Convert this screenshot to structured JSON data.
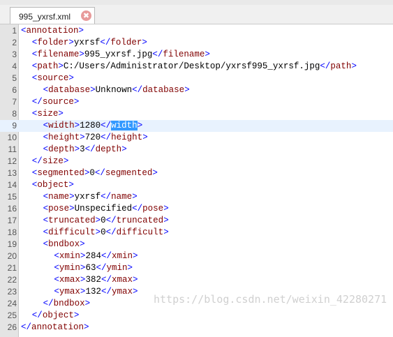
{
  "tab": {
    "name": "995_yxrsf.xml",
    "close_glyph": "✖"
  },
  "watermark": "https://blog.csdn.net/weixin_42280271",
  "current_line": 9,
  "lines": [
    {
      "n": "1",
      "indent": 0,
      "parts": [
        [
          "b",
          "<"
        ],
        [
          "t",
          "annotation"
        ],
        [
          "b",
          ">"
        ]
      ]
    },
    {
      "n": "2",
      "indent": 1,
      "parts": [
        [
          "b",
          "<"
        ],
        [
          "t",
          "folder"
        ],
        [
          "b",
          ">"
        ],
        [
          "x",
          "yxrsf"
        ],
        [
          "b",
          "</"
        ],
        [
          "t",
          "folder"
        ],
        [
          "b",
          ">"
        ]
      ]
    },
    {
      "n": "3",
      "indent": 1,
      "parts": [
        [
          "b",
          "<"
        ],
        [
          "t",
          "filename"
        ],
        [
          "b",
          ">"
        ],
        [
          "x",
          "995_yxrsf.jpg"
        ],
        [
          "b",
          "</"
        ],
        [
          "t",
          "filename"
        ],
        [
          "b",
          ">"
        ]
      ]
    },
    {
      "n": "4",
      "indent": 1,
      "parts": [
        [
          "b",
          "<"
        ],
        [
          "t",
          "path"
        ],
        [
          "b",
          ">"
        ],
        [
          "x",
          "C:/Users/Administrator/Desktop/yxrsf995_yxrsf.jpg"
        ],
        [
          "b",
          "</"
        ],
        [
          "t",
          "path"
        ],
        [
          "b",
          ">"
        ]
      ]
    },
    {
      "n": "5",
      "indent": 1,
      "parts": [
        [
          "b",
          "<"
        ],
        [
          "t",
          "source"
        ],
        [
          "b",
          ">"
        ]
      ]
    },
    {
      "n": "6",
      "indent": 2,
      "parts": [
        [
          "b",
          "<"
        ],
        [
          "t",
          "database"
        ],
        [
          "b",
          ">"
        ],
        [
          "x",
          "Unknown"
        ],
        [
          "b",
          "</"
        ],
        [
          "t",
          "database"
        ],
        [
          "b",
          ">"
        ]
      ]
    },
    {
      "n": "7",
      "indent": 1,
      "parts": [
        [
          "b",
          "</"
        ],
        [
          "t",
          "source"
        ],
        [
          "b",
          ">"
        ]
      ]
    },
    {
      "n": "8",
      "indent": 1,
      "parts": [
        [
          "b",
          "<"
        ],
        [
          "t",
          "size"
        ],
        [
          "b",
          ">"
        ]
      ]
    },
    {
      "n": "9",
      "indent": 2,
      "parts": [
        [
          "b",
          "<"
        ],
        [
          "t",
          "width"
        ],
        [
          "b",
          ">"
        ],
        [
          "x",
          "1280"
        ],
        [
          "b",
          "</"
        ],
        [
          "sel",
          "width"
        ],
        [
          "b",
          ">"
        ]
      ]
    },
    {
      "n": "10",
      "indent": 2,
      "parts": [
        [
          "b",
          "<"
        ],
        [
          "t",
          "height"
        ],
        [
          "b",
          ">"
        ],
        [
          "x",
          "720"
        ],
        [
          "b",
          "</"
        ],
        [
          "t",
          "height"
        ],
        [
          "b",
          ">"
        ]
      ]
    },
    {
      "n": "11",
      "indent": 2,
      "parts": [
        [
          "b",
          "<"
        ],
        [
          "t",
          "depth"
        ],
        [
          "b",
          ">"
        ],
        [
          "x",
          "3"
        ],
        [
          "b",
          "</"
        ],
        [
          "t",
          "depth"
        ],
        [
          "b",
          ">"
        ]
      ]
    },
    {
      "n": "12",
      "indent": 1,
      "parts": [
        [
          "b",
          "</"
        ],
        [
          "t",
          "size"
        ],
        [
          "b",
          ">"
        ]
      ]
    },
    {
      "n": "13",
      "indent": 1,
      "parts": [
        [
          "b",
          "<"
        ],
        [
          "t",
          "segmented"
        ],
        [
          "b",
          ">"
        ],
        [
          "x",
          "0"
        ],
        [
          "b",
          "</"
        ],
        [
          "t",
          "segmented"
        ],
        [
          "b",
          ">"
        ]
      ]
    },
    {
      "n": "14",
      "indent": 1,
      "parts": [
        [
          "b",
          "<"
        ],
        [
          "t",
          "object"
        ],
        [
          "b",
          ">"
        ]
      ]
    },
    {
      "n": "15",
      "indent": 2,
      "parts": [
        [
          "b",
          "<"
        ],
        [
          "t",
          "name"
        ],
        [
          "b",
          ">"
        ],
        [
          "x",
          "yxrsf"
        ],
        [
          "b",
          "</"
        ],
        [
          "t",
          "name"
        ],
        [
          "b",
          ">"
        ]
      ]
    },
    {
      "n": "16",
      "indent": 2,
      "parts": [
        [
          "b",
          "<"
        ],
        [
          "t",
          "pose"
        ],
        [
          "b",
          ">"
        ],
        [
          "x",
          "Unspecified"
        ],
        [
          "b",
          "</"
        ],
        [
          "t",
          "pose"
        ],
        [
          "b",
          ">"
        ]
      ]
    },
    {
      "n": "17",
      "indent": 2,
      "parts": [
        [
          "b",
          "<"
        ],
        [
          "t",
          "truncated"
        ],
        [
          "b",
          ">"
        ],
        [
          "x",
          "0"
        ],
        [
          "b",
          "</"
        ],
        [
          "t",
          "truncated"
        ],
        [
          "b",
          ">"
        ]
      ]
    },
    {
      "n": "18",
      "indent": 2,
      "parts": [
        [
          "b",
          "<"
        ],
        [
          "t",
          "difficult"
        ],
        [
          "b",
          ">"
        ],
        [
          "x",
          "0"
        ],
        [
          "b",
          "</"
        ],
        [
          "t",
          "difficult"
        ],
        [
          "b",
          ">"
        ]
      ]
    },
    {
      "n": "19",
      "indent": 2,
      "parts": [
        [
          "b",
          "<"
        ],
        [
          "t",
          "bndbox"
        ],
        [
          "b",
          ">"
        ]
      ]
    },
    {
      "n": "20",
      "indent": 3,
      "parts": [
        [
          "b",
          "<"
        ],
        [
          "t",
          "xmin"
        ],
        [
          "b",
          ">"
        ],
        [
          "x",
          "284"
        ],
        [
          "b",
          "</"
        ],
        [
          "t",
          "xmin"
        ],
        [
          "b",
          ">"
        ]
      ]
    },
    {
      "n": "21",
      "indent": 3,
      "parts": [
        [
          "b",
          "<"
        ],
        [
          "t",
          "ymin"
        ],
        [
          "b",
          ">"
        ],
        [
          "x",
          "63"
        ],
        [
          "b",
          "</"
        ],
        [
          "t",
          "ymin"
        ],
        [
          "b",
          ">"
        ]
      ]
    },
    {
      "n": "22",
      "indent": 3,
      "parts": [
        [
          "b",
          "<"
        ],
        [
          "t",
          "xmax"
        ],
        [
          "b",
          ">"
        ],
        [
          "x",
          "382"
        ],
        [
          "b",
          "</"
        ],
        [
          "t",
          "xmax"
        ],
        [
          "b",
          ">"
        ]
      ]
    },
    {
      "n": "23",
      "indent": 3,
      "parts": [
        [
          "b",
          "<"
        ],
        [
          "t",
          "ymax"
        ],
        [
          "b",
          ">"
        ],
        [
          "x",
          "132"
        ],
        [
          "b",
          "</"
        ],
        [
          "t",
          "ymax"
        ],
        [
          "b",
          ">"
        ]
      ]
    },
    {
      "n": "24",
      "indent": 2,
      "parts": [
        [
          "b",
          "</"
        ],
        [
          "t",
          "bndbox"
        ],
        [
          "b",
          ">"
        ]
      ]
    },
    {
      "n": "25",
      "indent": 1,
      "parts": [
        [
          "b",
          "</"
        ],
        [
          "t",
          "object"
        ],
        [
          "b",
          ">"
        ]
      ]
    },
    {
      "n": "26",
      "indent": 0,
      "parts": [
        [
          "b",
          "</"
        ],
        [
          "t",
          "annotation"
        ],
        [
          "b",
          ">"
        ]
      ]
    }
  ]
}
